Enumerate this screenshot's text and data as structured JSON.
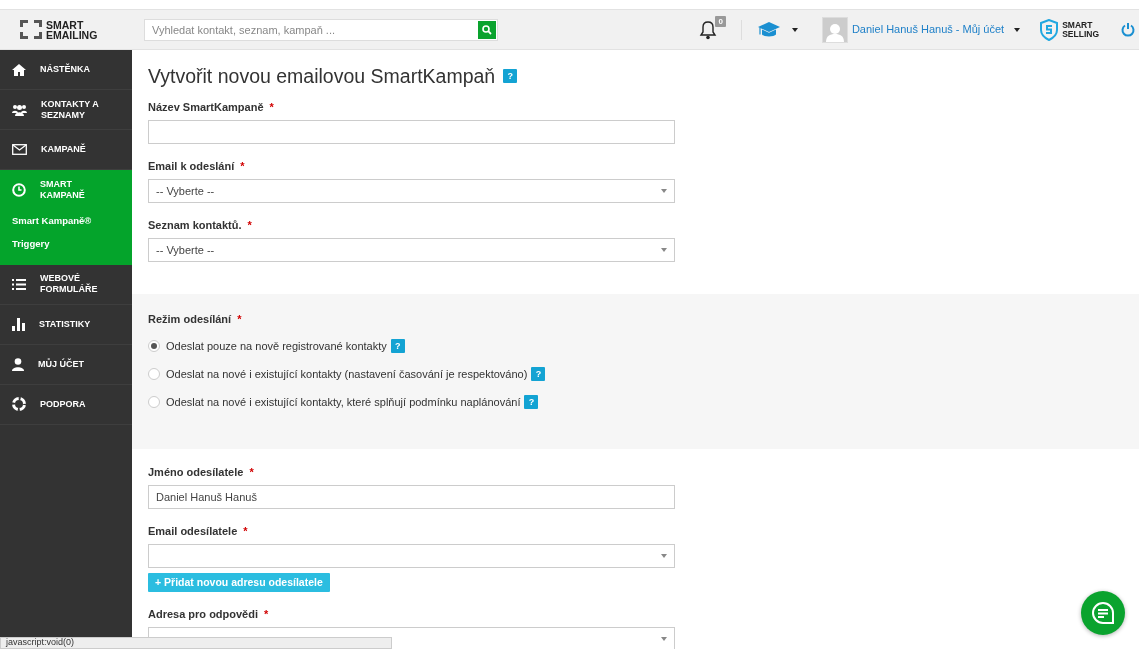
{
  "header": {
    "logo": [
      "SMART",
      "EMAILING"
    ],
    "search": {
      "placeholder": "Vyhledat kontakt, seznam, kampaň ..."
    },
    "notifications": {
      "count": "0"
    },
    "user": {
      "name": "Daniel Hanuš Hanuš - Můj účet"
    },
    "brand": [
      "SMART",
      "SELLING"
    ]
  },
  "sidebar": {
    "items": [
      {
        "label": "NÁSTĚNKA",
        "selected": false
      },
      {
        "label": "KONTAKTY A SEZNAMY",
        "selected": false
      },
      {
        "label": "KAMPANĚ",
        "selected": false
      },
      {
        "label": "SMART KAMPANĚ",
        "selected": true,
        "children": [
          {
            "label": "Smart Kampaně®"
          },
          {
            "label": "Triggery"
          }
        ]
      },
      {
        "label": "WEBOVÉ FORMULÁŘE",
        "selected": false
      },
      {
        "label": "STATISTIKY",
        "selected": false
      },
      {
        "label": "MŮJ ÚČET",
        "selected": false
      },
      {
        "label": "PODPORA",
        "selected": false
      }
    ]
  },
  "page": {
    "title": "Vytvořit novou emailovou SmartKampaň",
    "help": "?"
  },
  "sections": [
    {
      "fields": [
        {
          "kind": "input",
          "label": "Název SmartKampaně",
          "required": "*"
        },
        {
          "kind": "select",
          "label": "Email k odeslání",
          "required": "*",
          "value": "-- Vyberte --"
        },
        {
          "kind": "select",
          "label": "Seznam kontaktů.",
          "required": "*",
          "value": "-- Vyberte --"
        }
      ]
    },
    {
      "shaded": true,
      "fields": [
        {
          "kind": "radio",
          "label": "Režim odesílání",
          "required": "*",
          "options": [
            {
              "label": "Odeslat pouze na nově registrované kontakty",
              "help": "?",
              "selected": true
            },
            {
              "label": "Odeslat na nové i existující kontakty (nastavení časování je respektováno)",
              "help": "?",
              "selected": false
            },
            {
              "label": "Odeslat na nové i existující kontakty, které splňují podmínku naplánování",
              "help": "?",
              "selected": false
            }
          ]
        }
      ]
    },
    {
      "fields": [
        {
          "kind": "input",
          "label": "Jméno odesílatele",
          "required": "*",
          "value": "Daniel Hanuš Hanuš"
        },
        {
          "kind": "select",
          "label": "Email odesílatele",
          "required": "*",
          "action": "+ Přidat novou adresu odesílatele"
        },
        {
          "kind": "select",
          "label": "Adresa pro odpovědi",
          "required": "*"
        }
      ]
    }
  ],
  "status_bar": {
    "text": "javascript:void(0)"
  }
}
